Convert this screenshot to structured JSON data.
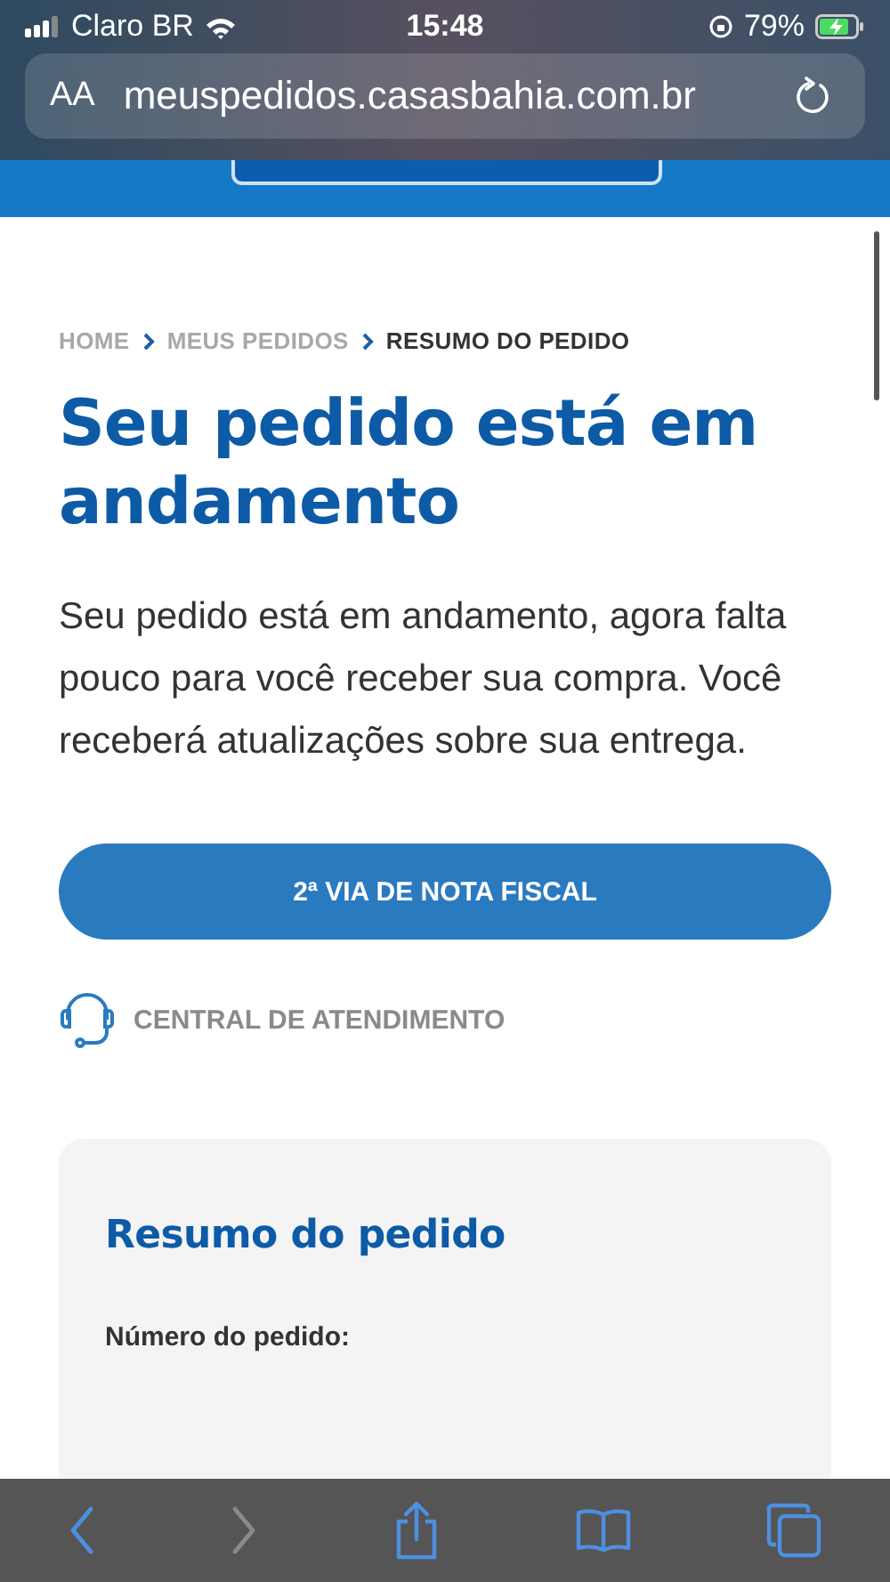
{
  "status_bar": {
    "carrier": "Claro BR",
    "time": "15:48",
    "battery": "79%"
  },
  "address_bar": {
    "text_size": "AA",
    "url": "meuspedidos.casasbahia.com.br"
  },
  "breadcrumbs": [
    {
      "label": "HOME",
      "selected": false
    },
    {
      "label": "MEUS PEDIDOS",
      "selected": false
    },
    {
      "label": "RESUMO DO PEDIDO",
      "selected": true
    }
  ],
  "title": "Seu pedido está em andamento",
  "description": "Seu pedido está em andamento, agora falta pouco para você receber sua compra. Você receberá atualizações sobre sua entrega.",
  "invoice_button": "2ª VIA DE NOTA FISCAL",
  "support_link": "CENTRAL DE ATENDIMENTO",
  "summary": {
    "title": "Resumo do pedido",
    "order_number_label": "Número do pedido:"
  },
  "toolbar": [
    {
      "kind": "back",
      "disabled": false
    },
    {
      "kind": "forward",
      "disabled": true
    },
    {
      "kind": "share",
      "disabled": false
    },
    {
      "kind": "bookmarks",
      "disabled": false
    },
    {
      "kind": "tabs",
      "disabled": false
    }
  ]
}
